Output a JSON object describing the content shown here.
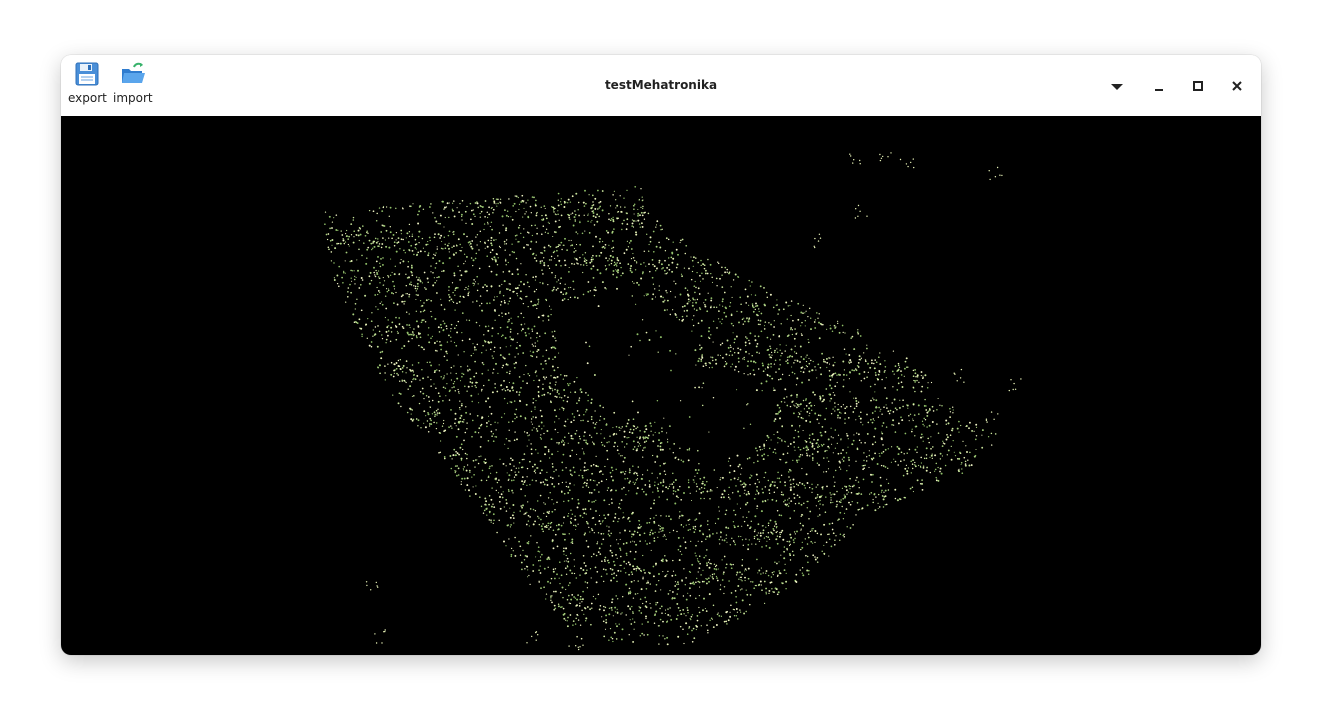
{
  "window": {
    "title": "testMehatronika"
  },
  "toolbar": {
    "export": {
      "label": "export",
      "icon": "save-floppy-icon"
    },
    "import": {
      "label": "import",
      "icon": "folder-open-icon"
    }
  },
  "window_controls": {
    "menu_icon": "dropdown-triangle-icon",
    "minimize_icon": "minimize-icon",
    "maximize_icon": "maximize-icon",
    "close_icon": "close-icon"
  },
  "viewport": {
    "background": "#000000",
    "point_colors": [
      "#e8f3b8",
      "#c7e39a",
      "#a7cf7d",
      "#f2f5c8",
      "#8fbf68"
    ]
  }
}
